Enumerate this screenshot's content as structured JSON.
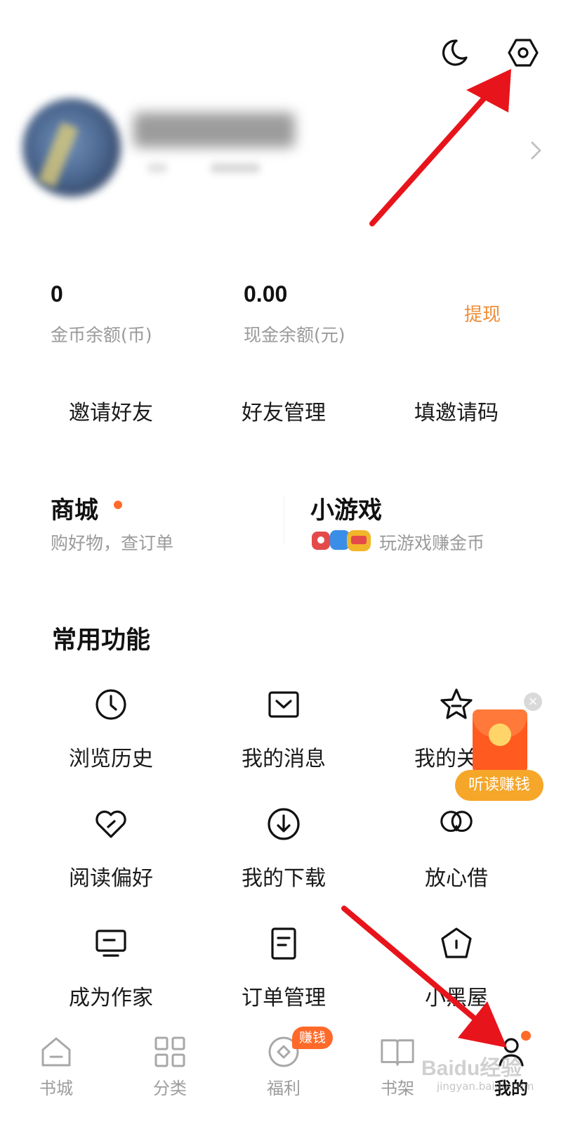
{
  "header": {
    "night_icon": "moon-icon",
    "settings_icon": "gear-icon"
  },
  "balance": {
    "coins_value": "0",
    "coins_label": "金币余额(币)",
    "cash_value": "0.00",
    "cash_label": "现金余额(元)",
    "withdraw_label": "提现"
  },
  "actions": [
    "邀请好友",
    "好友管理",
    "填邀请码"
  ],
  "cards": {
    "mall_title": "商城",
    "mall_sub": "购好物，查订单",
    "games_title": "小游戏",
    "games_sub": "玩游戏赚金币"
  },
  "section_title": "常用功能",
  "grid": [
    {
      "label": "浏览历史",
      "icon": "clock-icon"
    },
    {
      "label": "我的消息",
      "icon": "message-icon"
    },
    {
      "label": "我的关注",
      "icon": "star-icon"
    },
    {
      "label": "阅读偏好",
      "icon": "heart-check-icon"
    },
    {
      "label": "我的下载",
      "icon": "download-icon"
    },
    {
      "label": "放心借",
      "icon": "loan-icon"
    },
    {
      "label": "成为作家",
      "icon": "monitor-icon"
    },
    {
      "label": "订单管理",
      "icon": "document-icon"
    },
    {
      "label": "小黑屋",
      "icon": "house-icon"
    }
  ],
  "promo": {
    "label": "听读赚钱"
  },
  "tabs": [
    {
      "label": "书城",
      "icon": "home-icon"
    },
    {
      "label": "分类",
      "icon": "grid-icon"
    },
    {
      "label": "福利",
      "icon": "coin-icon"
    },
    {
      "label": "书架",
      "icon": "book-icon"
    },
    {
      "label": "我的",
      "icon": "profile-icon"
    }
  ],
  "welfare_badge": "赚钱",
  "watermark": {
    "main": "Baidu经验",
    "sub": "jingyan.baidu.com"
  },
  "colors": {
    "accent": "#f08c34",
    "badge": "#ff6a2a",
    "arrow": "#e8141b"
  }
}
